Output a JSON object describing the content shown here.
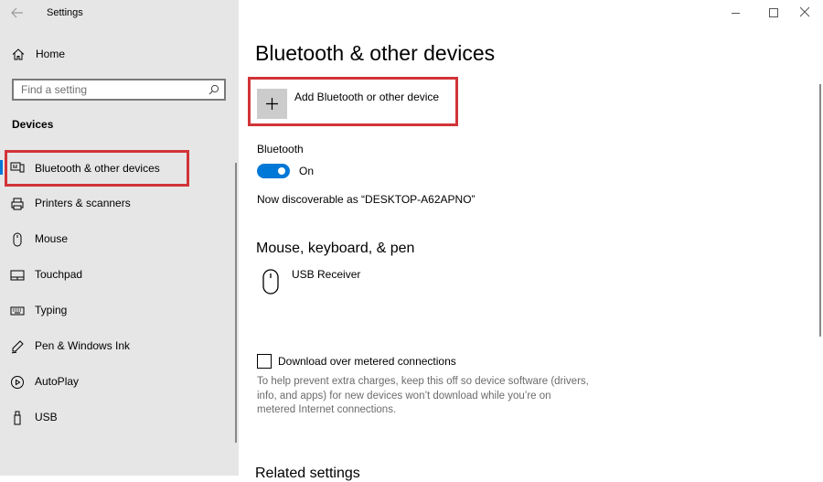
{
  "window": {
    "title": "Settings"
  },
  "sidebar": {
    "home_label": "Home",
    "search_placeholder": "Find a setting",
    "section_title": "Devices",
    "items": [
      {
        "label": "Bluetooth & other devices",
        "icon": "bluetooth-devices-icon",
        "selected": true
      },
      {
        "label": "Printers & scanners",
        "icon": "printer-icon"
      },
      {
        "label": "Mouse",
        "icon": "mouse-icon"
      },
      {
        "label": "Touchpad",
        "icon": "touchpad-icon"
      },
      {
        "label": "Typing",
        "icon": "keyboard-icon"
      },
      {
        "label": "Pen & Windows Ink",
        "icon": "pen-icon"
      },
      {
        "label": "AutoPlay",
        "icon": "autoplay-icon"
      },
      {
        "label": "USB",
        "icon": "usb-icon"
      }
    ]
  },
  "main": {
    "page_title": "Bluetooth & other devices",
    "add_device_label": "Add Bluetooth or other device",
    "bluetooth_label": "Bluetooth",
    "bluetooth_state": "On",
    "discoverable_text": "Now discoverable as “DESKTOP-A62APNO”",
    "mouse_section_title": "Mouse, keyboard, & pen",
    "usb_receiver_label": "USB Receiver",
    "metered_label": "Download over metered connections",
    "metered_help_line1": "To help prevent extra charges, keep this off so device software (drivers,",
    "metered_help_line2": "info, and apps) for new devices won’t download while you’re on",
    "metered_help_line3": "metered Internet connections.",
    "related_title": "Related settings"
  },
  "colors": {
    "accent": "#0078d7",
    "highlight_red": "#d13438",
    "sidebar_bg": "#e6e6e6"
  }
}
